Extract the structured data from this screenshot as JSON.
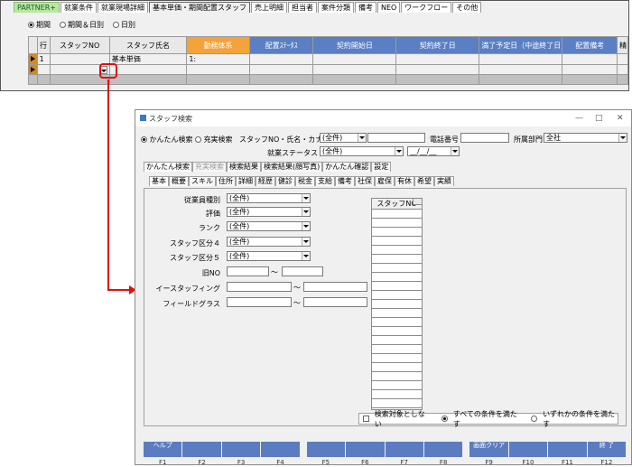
{
  "top": {
    "tabs": [
      {
        "label": "PARTNER+",
        "kind": "brand"
      },
      {
        "label": "就業条件"
      },
      {
        "label": "就業現場詳細"
      },
      {
        "label": "基本単価・期間配置スタッフ",
        "kind": "active"
      },
      {
        "label": "売上明細"
      },
      {
        "label": "担当者"
      },
      {
        "label": "案件分類"
      },
      {
        "label": "備考"
      },
      {
        "label": "NEO"
      },
      {
        "label": "ワークフロー"
      },
      {
        "label": "その他"
      }
    ],
    "period_options": [
      "期間",
      "期間＆日別",
      "日別"
    ],
    "period_selected": 0,
    "grid": {
      "headers": [
        "行",
        "スタッフNO",
        "スタッフ氏名",
        "勤務体系",
        "配置ｽﾃｰﾀｽ",
        "契約開始日",
        "契約終了日",
        "満了予定日（中途終了日）",
        "配置備考",
        "精"
      ],
      "rows": [
        [
          "1",
          "",
          "基本単価",
          "1:",
          "",
          "",
          "",
          "",
          "",
          ""
        ],
        [
          "",
          "",
          "",
          "",
          "",
          "",
          "",
          "",
          "",
          ""
        ]
      ]
    }
  },
  "search": {
    "title": "スタッフ検索",
    "mode_options": [
      "かんたん検索",
      "充実検索"
    ],
    "mode_selected": 0,
    "staff_label": "スタッフNO・氏名・カナ",
    "staff_value": "(全件)",
    "phone_label": "電話番号",
    "dept_label": "所属部門",
    "dept_value": "全社",
    "status_label": "就業ステータス",
    "status_value": "(全件)",
    "date_value": "__/__/__",
    "tabs1": [
      {
        "label": "かんたん検索",
        "active": true
      },
      {
        "label": "充実検索",
        "dim": true
      },
      {
        "label": "検索結果"
      },
      {
        "label": "検索結果(顔写真)"
      },
      {
        "label": "かんたん確認"
      },
      {
        "label": "設定"
      }
    ],
    "tabs2": [
      "基本",
      "概要",
      "スキル",
      "住所",
      "詳細",
      "経歴",
      "健診",
      "税金",
      "支給",
      "備考",
      "社保",
      "雇保",
      "有休",
      "希望",
      "実績"
    ],
    "fields": [
      {
        "label": "従業員種別",
        "value": "(全件)"
      },
      {
        "label": "評価",
        "value": "(全件)"
      },
      {
        "label": "ランク",
        "value": "(全件)"
      },
      {
        "label": "スタッフ区分４",
        "value": "(全件)"
      },
      {
        "label": "スタッフ区分５",
        "value": "(全件)"
      }
    ],
    "ranges": [
      {
        "label": "旧NO",
        "sep": "～"
      },
      {
        "label": "イースタッフィング",
        "sep": "～"
      },
      {
        "label": "フィールドグラス",
        "sep": "～"
      }
    ],
    "list_header": "スタッフNO",
    "exclude_label": "検索対象としない",
    "cond_all": "すべての条件を満たす",
    "cond_any": "いずれかの条件を満たす",
    "fkeys": [
      {
        "label": "ヘルプ",
        "fn": "F1"
      },
      {
        "label": "",
        "fn": "F2"
      },
      {
        "label": "",
        "fn": "F3"
      },
      {
        "label": "",
        "fn": "F4"
      },
      {
        "label": "",
        "fn": "F5"
      },
      {
        "label": "",
        "fn": "F6"
      },
      {
        "label": "",
        "fn": "F7"
      },
      {
        "label": "",
        "fn": "F8"
      },
      {
        "label": "画面クリア",
        "fn": "F9"
      },
      {
        "label": "",
        "fn": "F10"
      },
      {
        "label": "",
        "fn": "F11"
      },
      {
        "label": "終 了",
        "fn": "F12"
      }
    ]
  }
}
